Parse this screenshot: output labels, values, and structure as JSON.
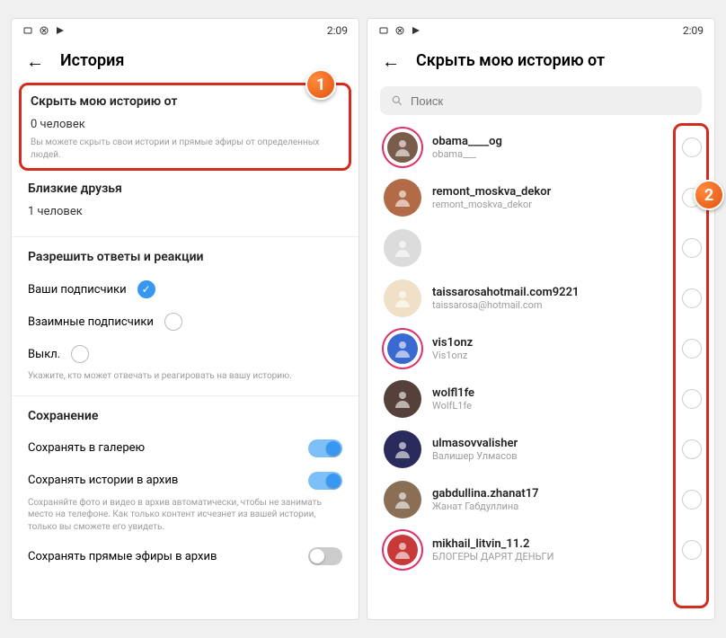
{
  "status_time": "2:09",
  "screen1": {
    "title": "История",
    "hide_section": {
      "title": "Скрыть мою историю от",
      "value": "0 человек",
      "hint": "Вы можете скрыть свои истории и прямые эфиры от определенных людей."
    },
    "close_friends": {
      "title": "Близкие друзья",
      "value": "1 человек"
    },
    "replies": {
      "title": "Разрешить ответы и реакции",
      "opt_followers": "Ваши подписчики",
      "opt_mutual": "Взаимные подписчики",
      "opt_off": "Выкл.",
      "hint": "Укажите, кто может отвечать и реагировать на вашу историю."
    },
    "saving": {
      "title": "Сохранение",
      "row_gallery": "Сохранять в галерею",
      "row_archive": "Сохранять истории в архив",
      "hint": "Сохраняйте фото и видео в архив автоматически, чтобы не занимать место на телефоне. Как только контент исчезнет из вашей истории, только вы сможете его увидеть.",
      "row_live_archive": "Сохранять прямые эфиры в архив"
    }
  },
  "screen2": {
    "title": "Скрыть мою историю от",
    "search_placeholder": "Поиск",
    "users": [
      {
        "name": "obama____og",
        "sub": "obama___",
        "ring": true
      },
      {
        "name": "remont_moskva_dekor",
        "sub": "remont_moskva_dekor",
        "ring": false
      },
      {
        "name": "",
        "sub": "",
        "ring": false
      },
      {
        "name": "taissarosahotmail.com9221",
        "sub": "taissarosa@hotmail.com",
        "ring": false
      },
      {
        "name": "vis1onz",
        "sub": "Vis1onz",
        "ring": true
      },
      {
        "name": "wolfl1fe",
        "sub": "WolfL1fe",
        "ring": false
      },
      {
        "name": "ulmasovvalisher",
        "sub": "Валишер Улмасов",
        "ring": false
      },
      {
        "name": "gabdullina.zhanat17",
        "sub": "Жанат Габдуллина",
        "ring": false
      },
      {
        "name": "mikhail_litvin_11.2",
        "sub": "БЛОГЕРЫ ДАРЯТ ДЕНЬГИ",
        "ring": true
      }
    ]
  },
  "callouts": {
    "c1": "1",
    "c2": "2"
  }
}
